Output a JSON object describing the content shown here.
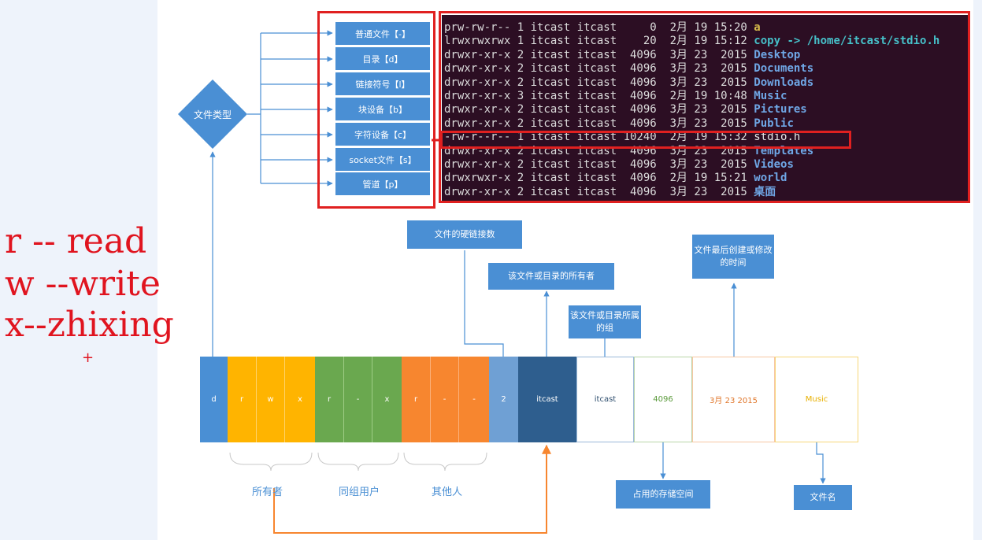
{
  "file_types": {
    "root_label": "文件类型",
    "items": [
      "普通文件【-】",
      "目录【d】",
      "链接符号【l】",
      "块设备【b】",
      "字符设备【c】",
      "socket文件【s】",
      "管道【p】"
    ]
  },
  "terminal": {
    "lines": [
      {
        "text": "prw-rw-r-- 1 itcast itcast     0  2月 19 15:20 ",
        "name": "a",
        "kind": "pipe"
      },
      {
        "text": "lrwxrwxrwx 1 itcast itcast    20  2月 19 15:12 ",
        "name": "copy -> /home/itcast/stdio.h",
        "kind": "link"
      },
      {
        "text": "drwxr-xr-x 2 itcast itcast  4096  3月 23  2015 ",
        "name": "Desktop",
        "kind": "dir"
      },
      {
        "text": "drwxr-xr-x 2 itcast itcast  4096  3月 23  2015 ",
        "name": "Documents",
        "kind": "dir"
      },
      {
        "text": "drwxr-xr-x 2 itcast itcast  4096  3月 23  2015 ",
        "name": "Downloads",
        "kind": "dir"
      },
      {
        "text": "drwxr-xr-x 3 itcast itcast  4096  2月 19 10:48 ",
        "name": "Music",
        "kind": "dir"
      },
      {
        "text": "drwxr-xr-x 2 itcast itcast  4096  3月 23  2015 ",
        "name": "Pictures",
        "kind": "dir"
      },
      {
        "text": "drwxr-xr-x 2 itcast itcast  4096  3月 23  2015 ",
        "name": "Public",
        "kind": "dir"
      },
      {
        "text": "-rw-r--r-- 1 itcast itcast 10240  2月 19 15:32 ",
        "name": "stdio.h",
        "kind": "plain"
      },
      {
        "text": "drwxr-xr-x 2 itcast itcast  4096  3月 23  2015 ",
        "name": "Templates",
        "kind": "dir"
      },
      {
        "text": "drwxr-xr-x 2 itcast itcast  4096  3月 23  2015 ",
        "name": "Videos",
        "kind": "dir"
      },
      {
        "text": "drwxrwxr-x 2 itcast itcast  4096  2月 19 15:21 ",
        "name": "world",
        "kind": "dir"
      },
      {
        "text": "drwxr-xr-x 2 itcast itcast  4096  3月 23  2015 ",
        "name": "桌面",
        "kind": "dir"
      }
    ]
  },
  "callouts": {
    "hard_links": "文件的硬链接数",
    "owner": "该文件或目录的所有者",
    "group": "该文件或目录所属的组",
    "mtime": "文件最后创建或修改的时间",
    "size": "占用的存储空间",
    "filename": "文件名"
  },
  "bar": {
    "type": "d",
    "owner": [
      "r",
      "w",
      "x"
    ],
    "group": [
      "r",
      "-",
      "x"
    ],
    "others": [
      "r",
      "-",
      "-"
    ],
    "links": "2",
    "user": "itcast",
    "grp": "itcast",
    "size": "4096",
    "date": "3月 23 2015",
    "name": "Music"
  },
  "groups": {
    "owner": "所有者",
    "group": "同组用户",
    "others": "其他人"
  },
  "handwritten": {
    "line1": "r -- read",
    "line2": "w --write",
    "line3": "x--zhixing",
    "plus": "+"
  },
  "colors": {
    "blue": "#4a8fd4",
    "yellow": "#ffb400",
    "green": "#6aa84f",
    "orange": "#f7862f",
    "light_blue": "#6fa0d4",
    "dark_blue": "#2e5e8e",
    "red": "#e02020"
  }
}
